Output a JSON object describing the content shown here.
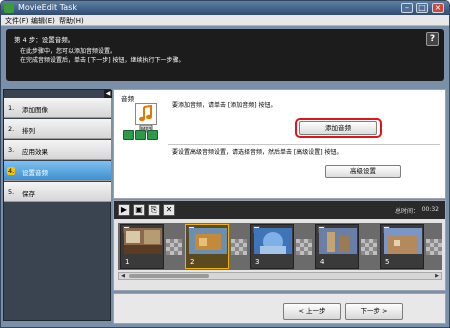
{
  "window": {
    "title": "MovieEdit Task",
    "minimize_icon": "minimize-icon",
    "maximize_icon": "maximize-icon",
    "close_icon": "close-icon"
  },
  "menu": {
    "items": [
      "文件(F)",
      "编辑(E)",
      "帮助(H)"
    ]
  },
  "banner": {
    "title": "第 4 步：设置音频。",
    "line1": "在此步骤中，您可以添加音频设置。",
    "line2": "在完成音频设置后，单击 [下一步] 按钮，继续执行下一步骤。",
    "help_label": "?"
  },
  "sidebar": {
    "items": [
      {
        "num": "1.",
        "label": "添加图像"
      },
      {
        "num": "2.",
        "label": "排列"
      },
      {
        "num": "3.",
        "label": "应用效果"
      },
      {
        "num": "4.",
        "label": "设置音频",
        "active": true
      },
      {
        "num": "5.",
        "label": "保存"
      }
    ]
  },
  "audio_panel": {
    "section_label": "音频",
    "add_hint": "要添加音频，请单击 [添加音频] 按钮。",
    "add_button": "添加音频",
    "advanced_hint": "要设置高级音频设置，请选择音频，然后单击 [高级设置] 按钮。",
    "advanced_button": "高级设置",
    "music_icon": "music-note-icon"
  },
  "timeline": {
    "total_time_label": "总时间：",
    "total_time_value": "00:32",
    "clips": [
      {
        "num": "1",
        "selected": false
      },
      {
        "num": "2",
        "selected": true
      },
      {
        "num": "3",
        "selected": false
      },
      {
        "num": "4",
        "selected": false
      },
      {
        "num": "5",
        "selected": false
      }
    ]
  },
  "nav": {
    "prev": "< 上一步",
    "next": "下一步 >"
  },
  "colors": {
    "highlight_ring": "#e0141a",
    "active_step": "#3f8fd0",
    "banner_bg": "#1c1c1c"
  }
}
